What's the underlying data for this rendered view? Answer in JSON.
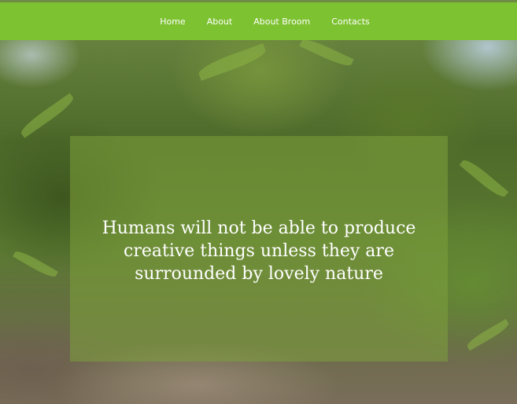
{
  "nav": {
    "items": [
      {
        "label": "Home"
      },
      {
        "label": "About"
      },
      {
        "label": "About Broom"
      },
      {
        "label": "Contacts"
      }
    ],
    "background_color": "#7dc231",
    "text_color": "#ffffff"
  },
  "hero": {
    "quote": "Humans will not be able to produce creative things unless they are surrounded by lovely nature",
    "overlay_color": "#7da03c"
  }
}
